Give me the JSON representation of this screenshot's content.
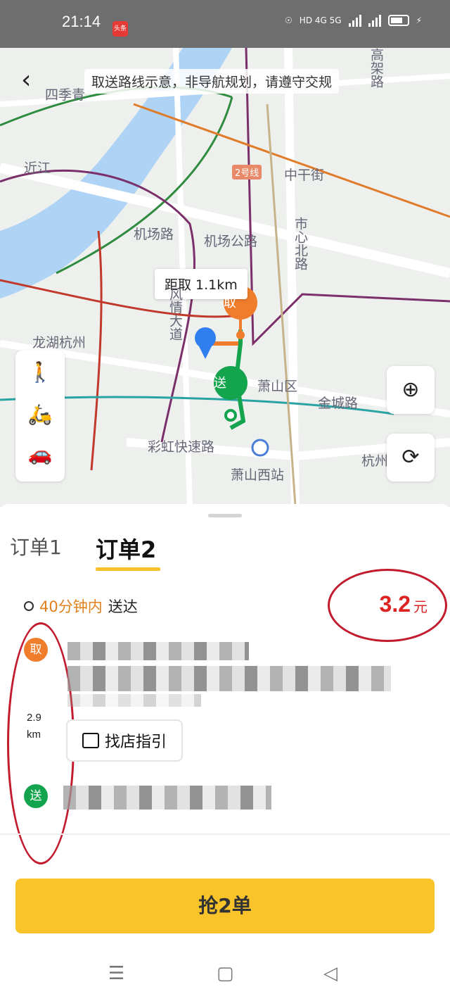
{
  "status_bar": {
    "time": "21:14",
    "app_badge": "头条",
    "network": "HD 4G 5G",
    "icons": [
      "location-icon",
      "hd-icon",
      "signal-icon",
      "signal-icon",
      "battery-icon",
      "charging-icon"
    ]
  },
  "map": {
    "notice": "取送路线示意，非导航规划，请遵守交规",
    "distance_to_pickup": "距取 1.1km",
    "pickup_marker": "取",
    "dropoff_marker": "送",
    "labels": [
      "四季青",
      "近江",
      "机场公路",
      "机场路",
      "市心北路",
      "高架路",
      "萧山区",
      "金城路",
      "彩虹快速路",
      "萧山西站",
      "龙湖杭州天街",
      "风情大道",
      "杭州",
      "2号线",
      "中干街"
    ],
    "modes": [
      "walk-icon",
      "scooter-icon",
      "car-icon"
    ],
    "accent_colors": {
      "pickup": "#ef7d2c",
      "dropoff": "#14a44d",
      "route": "#14a44d",
      "me": "#2f7ff0"
    }
  },
  "sheet": {
    "tabs": [
      "订单1",
      "订单2"
    ],
    "active_tab": 1,
    "eta_time": "40分钟内",
    "eta_suffix": "送达",
    "price": "3.2",
    "price_unit": "元",
    "pickup_label": "取",
    "dropoff_label": "送",
    "distance_value": "2.9",
    "distance_unit": "km",
    "guide_button": "找店指引",
    "grab_button": "抢2单"
  }
}
